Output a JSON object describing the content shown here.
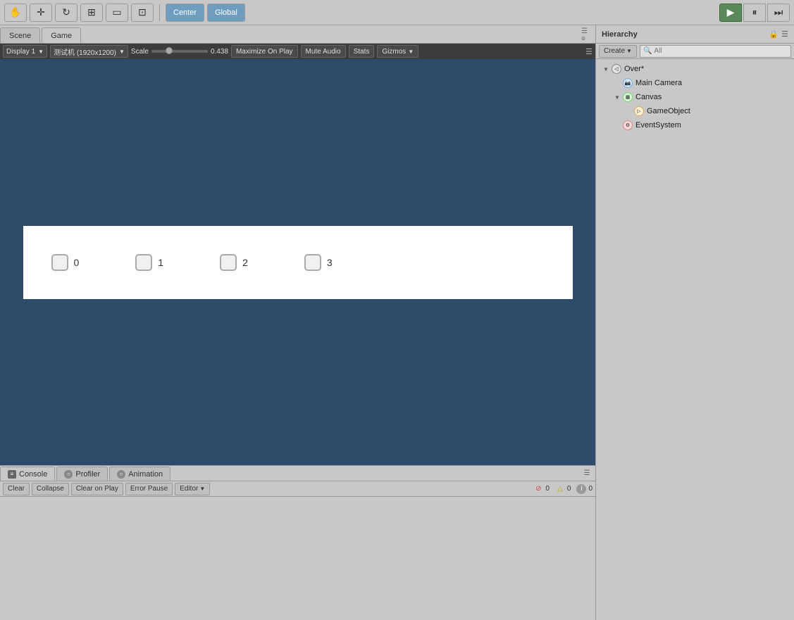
{
  "toolbar": {
    "hand_tool": "✋",
    "move_tool": "✛",
    "rotate_tool": "↺",
    "scale_tool": "⊞",
    "rect_tool": "▭",
    "transform_tool": "⊡",
    "pivot_label": "Center",
    "space_label": "Global",
    "play_btn": "▶",
    "pause_btn": "⏸",
    "step_btn": "⏭"
  },
  "tabs": {
    "scene_label": "Scene",
    "game_label": "Game"
  },
  "game_toolbar": {
    "display_label": "Display 1",
    "resolution_label": "测试机 (1920x1200)",
    "scale_label": "Scale",
    "scale_value": "0.438",
    "maximize_label": "Maximize On Play",
    "mute_label": "Mute Audio",
    "stats_label": "Stats",
    "gizmos_label": "Gizmos"
  },
  "game_items": [
    {
      "id": 0,
      "label": "0"
    },
    {
      "id": 1,
      "label": "1"
    },
    {
      "id": 2,
      "label": "2"
    },
    {
      "id": 3,
      "label": "3"
    }
  ],
  "console": {
    "tab_label": "Console",
    "profiler_label": "Profiler",
    "animation_label": "Animation",
    "clear_btn": "Clear",
    "collapse_btn": "Collapse",
    "clear_on_play_btn": "Clear on Play",
    "error_pause_btn": "Error Pause",
    "editor_btn": "Editor",
    "error_count": "0",
    "warn_count": "0",
    "info_count": "0"
  },
  "hierarchy": {
    "title": "Hierarchy",
    "create_btn": "Create",
    "search_placeholder": "All",
    "tree": [
      {
        "level": 0,
        "label": "Over*",
        "has_arrow": true,
        "arrow_open": true,
        "icon_type": "default"
      },
      {
        "level": 1,
        "label": "Main Camera",
        "has_arrow": false,
        "icon_type": "camera"
      },
      {
        "level": 1,
        "label": "Canvas",
        "has_arrow": true,
        "arrow_open": true,
        "icon_type": "canvas"
      },
      {
        "level": 2,
        "label": "GameObject",
        "has_arrow": false,
        "icon_type": "go"
      },
      {
        "level": 1,
        "label": "EventSystem",
        "has_arrow": false,
        "icon_type": "es"
      }
    ]
  }
}
